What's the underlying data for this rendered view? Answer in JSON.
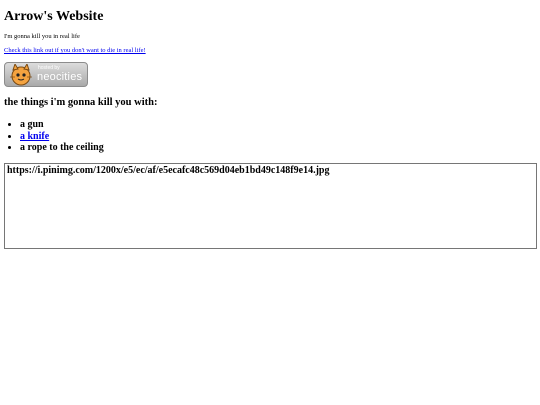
{
  "site": {
    "title": "Arrow's Website",
    "tagline": "I'm gonna kill you in real life",
    "warning_link": "Check this link out if you don't want to die in real life!"
  },
  "badge": {
    "small_text": "hosted by",
    "big_text": "neocities",
    "icon": "neocities-cat-icon"
  },
  "weapons": {
    "heading": "the things i'm gonna kill you with:",
    "items": [
      {
        "label": "a gun",
        "is_link": false
      },
      {
        "label": "a knife",
        "is_link": true
      },
      {
        "label": "a rope to the ceiling",
        "is_link": false
      }
    ]
  },
  "image_box": {
    "text": "https://i.pinimg.com/1200x/e5/ec/af/e5ecafc48c569d04eb1bd49c148f9e14.jpg"
  },
  "colors": {
    "link": "#0000ee",
    "background": "#ffffff",
    "text": "#000000"
  }
}
